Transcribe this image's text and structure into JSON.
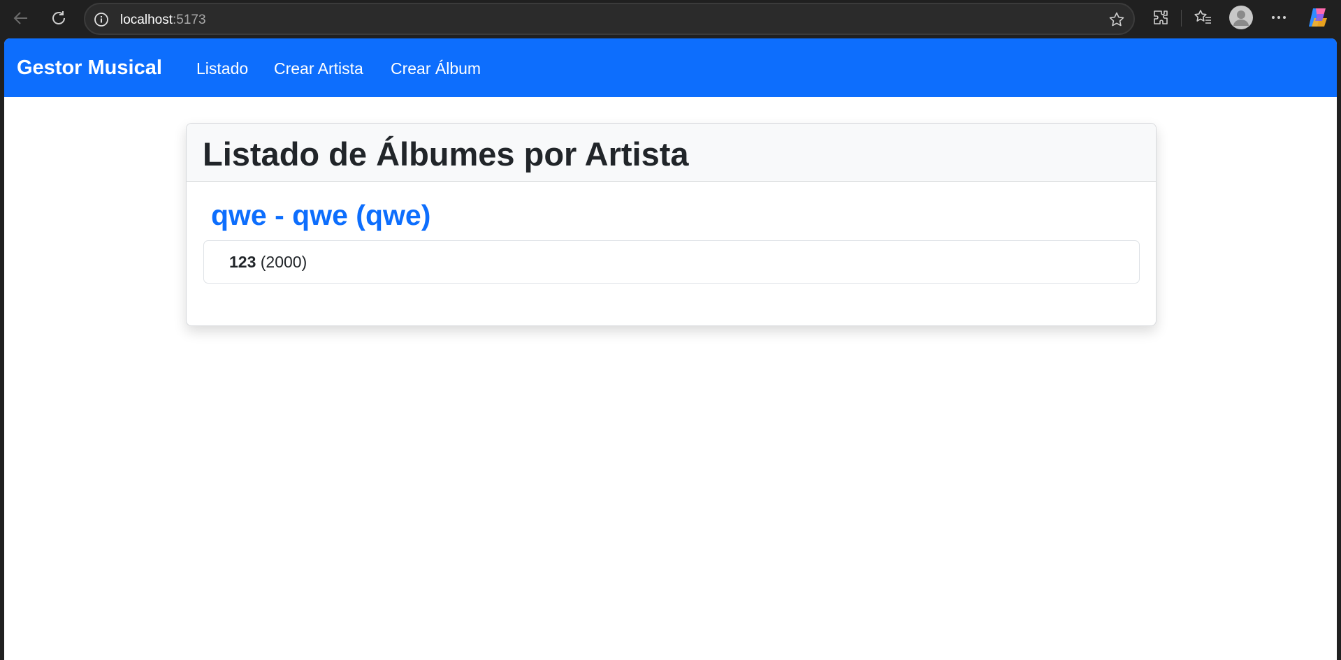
{
  "browser": {
    "url_host": "localhost",
    "url_port": ":5173"
  },
  "navbar": {
    "brand": "Gestor Musical",
    "links": [
      {
        "label": "Listado"
      },
      {
        "label": "Crear Artista"
      },
      {
        "label": "Crear Álbum"
      }
    ],
    "color": "#0d6efd"
  },
  "main": {
    "title": "Listado de Álbumes por Artista",
    "artists": [
      {
        "heading": "qwe - qwe (qwe)",
        "albums": [
          {
            "name": "123",
            "year": "(2000)"
          }
        ]
      }
    ]
  },
  "icons": [
    "back-arrow-icon",
    "refresh-icon",
    "info-icon",
    "star-icon",
    "extensions-icon",
    "favorites-icon",
    "avatar",
    "more-icon",
    "copilot-icon"
  ]
}
